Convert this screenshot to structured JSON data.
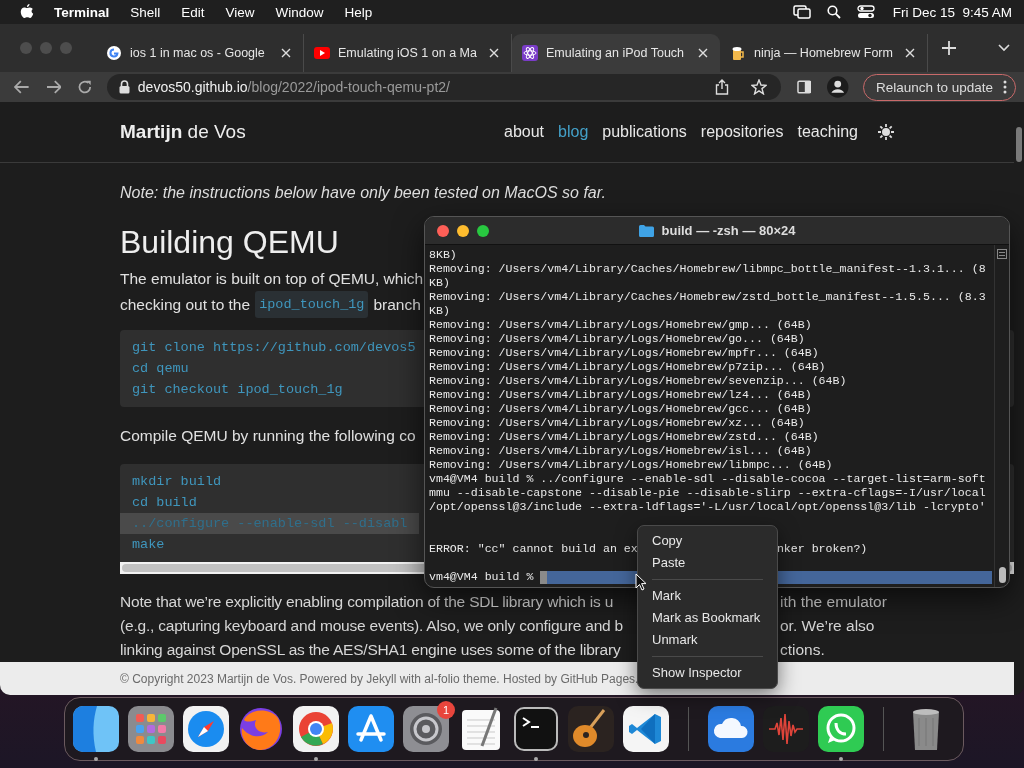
{
  "menubar": {
    "app": "Terminal",
    "menus": [
      "Shell",
      "Edit",
      "View",
      "Window",
      "Help"
    ],
    "clock": "Fri Dec 15  9:45 AM"
  },
  "browser": {
    "tabs": [
      {
        "title": "ios 1 in mac os - Google",
        "selected": false
      },
      {
        "title": "Emulating iOS 1 on a Ma",
        "selected": false
      },
      {
        "title": "Emulating an iPod Touch",
        "selected": true
      },
      {
        "title": "ninja — Homebrew Form",
        "selected": false
      }
    ],
    "address": {
      "host": "devos50.github.io",
      "path": "/blog/2022/ipod-touch-qemu-pt2/"
    },
    "relaunch": "Relaunch to update"
  },
  "page": {
    "brand": "**Martijn** de Vos",
    "nav": [
      {
        "label": "about",
        "selected": false
      },
      {
        "label": "blog",
        "selected": true
      },
      {
        "label": "publications",
        "selected": false
      },
      {
        "label": "repositories",
        "selected": false
      },
      {
        "label": "teaching",
        "selected": false
      }
    ],
    "note": "Note: the instructions below have only been tested on MacOS so far.",
    "heading": "Building QEMU",
    "intro": "The emulator is built on top of QEMU, which",
    "checkout": {
      "before": "checking out to the",
      "code": "ipod_touch_1g",
      "after": "branch"
    },
    "code_1": [
      "git clone https://github.com/devos5",
      "cd qemu",
      "git checkout ipod_touch_1g"
    ],
    "compile": "Compile QEMU by running the following co",
    "code_2": [
      {
        "text": "mkdir build",
        "selected": false
      },
      {
        "text": "cd build",
        "selected": false
      },
      {
        "text": "../configure --enable-sdl --disabl",
        "selected": true
      },
      {
        "text": "make",
        "selected": false
      }
    ],
    "closing": [
      {
        "left": "Note that we’re explicitly enabling compilation of the SDL library which is u",
        "right": "ith the emulator"
      },
      {
        "left": "(e.g., capturing keyboard and mouse events). Also, we only configure and b",
        "right": "or. We’re also"
      },
      {
        "left": "linking against OpenSSL as the AES/SHA1 engine uses some of the library",
        "right": "ctions."
      }
    ],
    "footer": "© Copyright 2023 Martijn de Vos. Powered by Jekyll with al-folio theme. Hosted by GitHub Pages."
  },
  "terminal": {
    "title": "build — -zsh — 80×24",
    "lines": [
      "8KB)",
      "Removing: /Users/vm4/Library/Caches/Homebrew/libmpc_bottle_manifest--1.3.1... (8",
      "KB)",
      "Removing: /Users/vm4/Library/Caches/Homebrew/zstd_bottle_manifest--1.5.5... (8.3",
      "KB)",
      "Removing: /Users/vm4/Library/Logs/Homebrew/gmp... (64B)",
      "Removing: /Users/vm4/Library/Logs/Homebrew/go... (64B)",
      "Removing: /Users/vm4/Library/Logs/Homebrew/mpfr... (64B)",
      "Removing: /Users/vm4/Library/Logs/Homebrew/p7zip... (64B)",
      "Removing: /Users/vm4/Library/Logs/Homebrew/sevenzip... (64B)",
      "Removing: /Users/vm4/Library/Logs/Homebrew/lz4... (64B)",
      "Removing: /Users/vm4/Library/Logs/Homebrew/gcc... (64B)",
      "Removing: /Users/vm4/Library/Logs/Homebrew/xz... (64B)",
      "Removing: /Users/vm4/Library/Logs/Homebrew/zstd... (64B)",
      "Removing: /Users/vm4/Library/Logs/Homebrew/isl... (64B)",
      "Removing: /Users/vm4/Library/Logs/Homebrew/libmpc... (64B)",
      "vm4@VM4 build % ../configure --enable-sdl --disable-cocoa --target-list=arm-soft",
      "mmu --disable-capstone --disable-pie --disable-slirp --extra-cflags=-I/usr/local",
      "/opt/openssl@3/include --extra-ldflags='-L/usr/local/opt/openssl@3/lib -lcrypto'"
    ],
    "error": {
      "left": "ERROR: \"cc\" cannot build an ex",
      "right": "nker broken?)"
    },
    "prompt": "vm4@VM4 build %"
  },
  "context_menu": {
    "groups": [
      [
        "Copy",
        "Paste"
      ],
      [
        "Mark",
        "Mark as Bookmark",
        "Unmark"
      ],
      [
        "Show Inspector"
      ]
    ]
  },
  "dock": {
    "groups": [
      {
        "apps": [
          {
            "running": true
          },
          {
            "running": false
          },
          {
            "running": false
          },
          {
            "running": false
          },
          {
            "running": true
          },
          {
            "running": false
          },
          {
            "running": false,
            "badge": "1"
          },
          {
            "running": false
          },
          {
            "running": true
          },
          {
            "running": false
          },
          {
            "running": false
          }
        ]
      },
      {
        "apps": [
          {
            "running": false
          },
          {
            "running": false
          },
          {
            "running": true
          }
        ]
      },
      {
        "apps": [
          {
            "running": false
          }
        ]
      }
    ]
  }
}
